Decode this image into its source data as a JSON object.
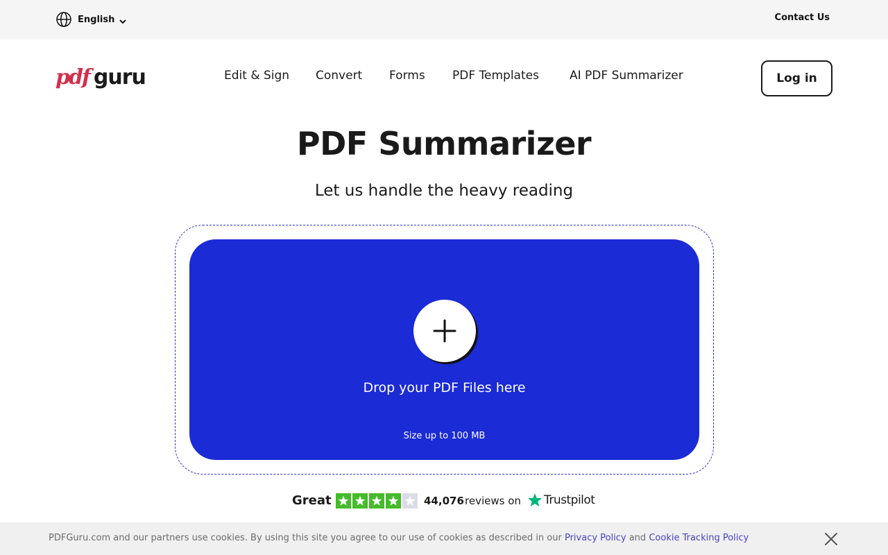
{
  "topbar": {
    "language": "English",
    "contact": "Contact Us"
  },
  "header": {
    "logo_pdf": "pdf",
    "logo_guru": "guru",
    "nav": [
      "Edit & Sign",
      "Convert",
      "Forms",
      "PDF Templates",
      "AI PDF Summarizer"
    ],
    "login": "Log in"
  },
  "hero": {
    "title": "PDF Summarizer",
    "subtitle": "Let us handle the heavy reading"
  },
  "dropzone": {
    "label": "Drop your PDF Files here",
    "size_note": "Size up to 100 MB"
  },
  "rating": {
    "label": "Great",
    "stars_filled": 4,
    "stars_total": 5,
    "count": "44,076",
    "reviews_text": "reviews on",
    "provider": "Trustpilot"
  },
  "cookie": {
    "message": "PDFGuru.com and our partners use cookies. By using this site you agree to our use of cookies as described in our",
    "privacy_link": "Privacy Policy",
    "and": "and",
    "tracking_link": "Cookie Tracking Policy"
  },
  "colors": {
    "brand_red": "#d1304d",
    "dropzone_blue": "#1b2bd6",
    "star_green": "#45bb2a",
    "trustpilot_green": "#00b67a",
    "link_purple": "#4a3fc4"
  },
  "icons": {
    "language": "globe-icon",
    "language_toggle": "chevron-down-icon",
    "upload": "plus-icon",
    "rating": "star-icon",
    "provider": "trustpilot-star-icon",
    "dismiss": "close-icon"
  }
}
